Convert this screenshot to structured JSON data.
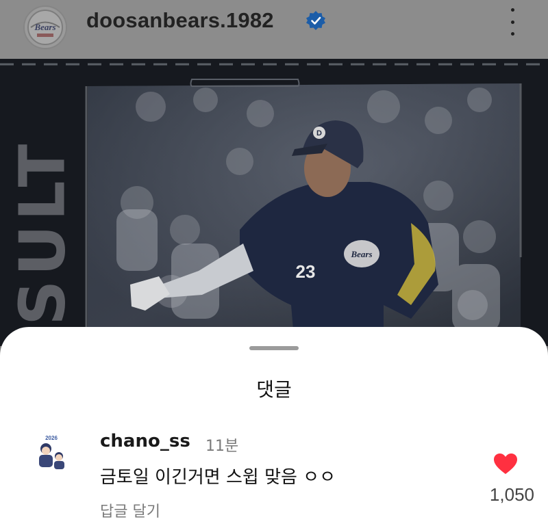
{
  "header": {
    "username": "doosanbears.1982",
    "avatar_icon": "doosan-bears-logo",
    "verified_icon": "verified-badge-icon",
    "more_icon": "more-vertical-icon"
  },
  "post": {
    "side_text": "RESULT",
    "jersey_number": "23"
  },
  "comments_sheet": {
    "title": "댓글",
    "comments": [
      {
        "username": "chano_ss",
        "time": "11분",
        "text": "금토일 이긴거면 스윕 맞음 ㅇㅇ",
        "reply_label": "답글 달기",
        "like_count": "1,050",
        "liked": true
      }
    ]
  },
  "colors": {
    "heart": "#ff3040",
    "verified": "#1877f2"
  }
}
